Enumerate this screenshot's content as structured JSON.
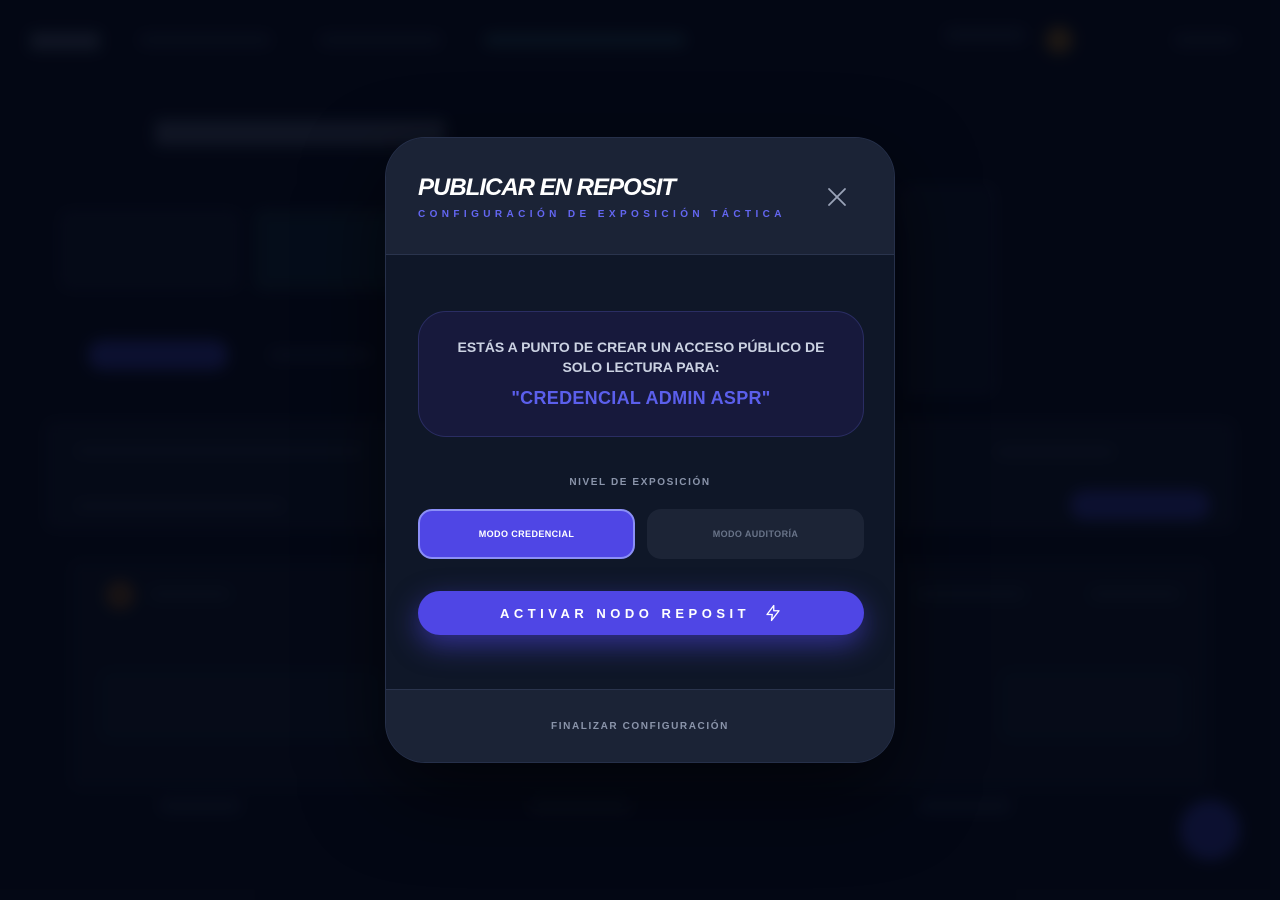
{
  "modal": {
    "title": "PUBLICAR EN REPOSIT",
    "subtitle": "CONFIGURACIÓN DE EXPOSICIÓN TÁCTICA",
    "close_icon": "close-icon",
    "info": {
      "message": "ESTÁS A PUNTO DE CREAR UN ACCESO PÚBLICO DE SOLO LECTURA PARA:",
      "target": "\"CREDENCIAL ADMIN ASPR\""
    },
    "exposure_level": {
      "label": "NIVEL DE EXPOSICIÓN",
      "options": [
        "MODO CREDENCIAL",
        "MODO AUDITORÍA"
      ],
      "selected": "MODO CREDENCIAL"
    },
    "activate_button": {
      "label": "ACTIVAR NODO REPOSIT",
      "icon": "lightning-icon"
    },
    "footer_button": "FINALIZAR CONFIGURACIÓN"
  },
  "colors": {
    "accent": "#4f46e5",
    "accent_text": "#5b5fec",
    "modal_bg": "#0f1728",
    "header_bg": "#1b2336",
    "page_bg": "#060b1a"
  }
}
